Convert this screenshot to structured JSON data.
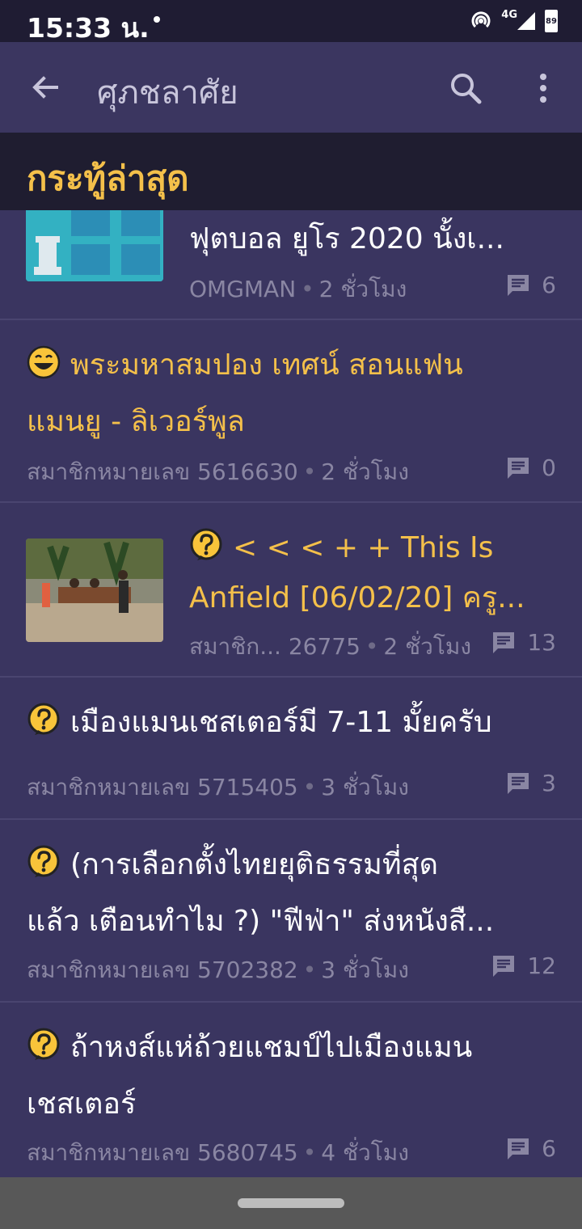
{
  "status": {
    "time": "15:33 น.",
    "network": "4G",
    "battery": "89"
  },
  "appbar": {
    "title": "ศุภชลาศัย"
  },
  "section": {
    "label": "กระทู้ล่าสุด"
  },
  "posts": [
    {
      "title": "ฟุตบอล ยูโร 2020 นั้งเ...",
      "author": "OMGMAN",
      "time": "2 ชั่วโมง",
      "comments": "6",
      "icon": "none",
      "state": "read"
    },
    {
      "title_line1": "พระมหาสมปอง เทศน์ สอนแฟน",
      "title_line2": "แมนยู - ลิเวอร์พูล",
      "author": "สมาชิกหมายเลข 5616630",
      "time": "2 ชั่วโมง",
      "comments": "0",
      "icon": "laugh-emoji-icon",
      "state": "unread"
    },
    {
      "title_line1": "< < < + + This Is",
      "title_line2": "Anfield [06/02/20] ครู...",
      "author": "สมาชิก... 26775",
      "time": "2 ชั่วโมง",
      "comments": "13",
      "icon": "question-icon",
      "state": "unread"
    },
    {
      "title_line1": "เมืองแมนเชสเตอร์มี 7-11 มั้ยครับ",
      "author": "สมาชิกหมายเลข 5715405",
      "time": "3 ชั่วโมง",
      "comments": "3",
      "icon": "question-icon",
      "state": "read"
    },
    {
      "title_line1": "(การเลือกตั้งไทยยุติธรรมที่สุด",
      "title_line2": "แล้ว เตือนทำไม ?) \"ฟีฟ่า\" ส่งหนังสื...",
      "author": "สมาชิกหมายเลข 5702382",
      "time": "3 ชั่วโมง",
      "comments": "12",
      "icon": "question-icon",
      "state": "read"
    },
    {
      "title_line1": "ถ้าหงส์แห่ถ้วยแชมป์ไปเมืองแมน",
      "title_line2": "เชสเตอร์",
      "author": "สมาชิกหมายเลข 5680745",
      "time": "4 ชั่วโมง",
      "comments": "6",
      "icon": "question-icon",
      "state": "read"
    }
  ]
}
